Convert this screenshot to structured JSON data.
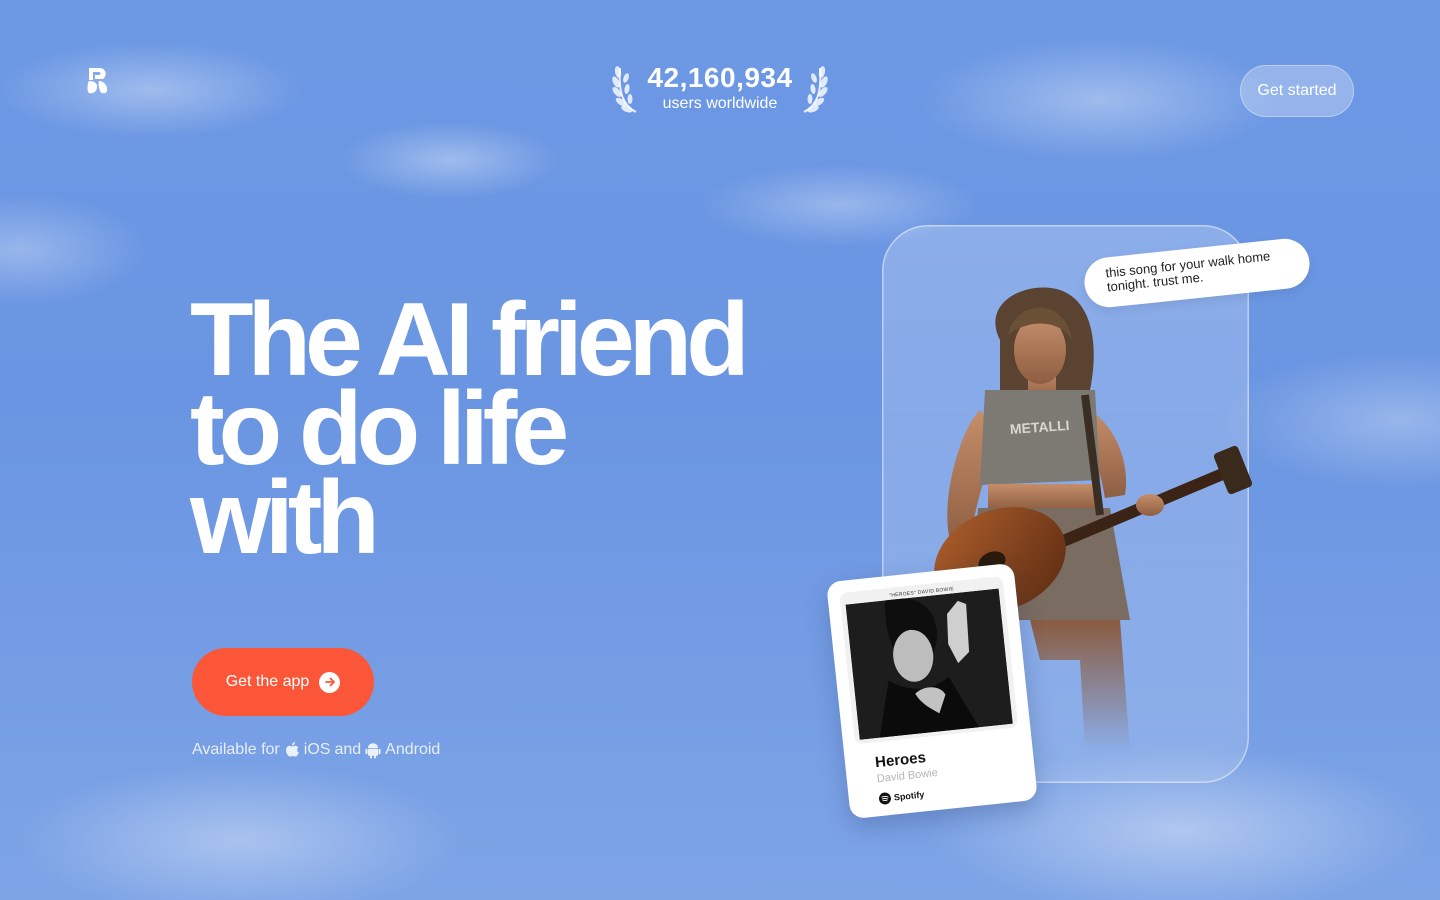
{
  "header": {
    "logo_icon": "replika-logo-icon",
    "user_count": "42,160,934",
    "user_count_label": "users worldwide",
    "get_started_label": "Get started"
  },
  "hero": {
    "headline_lines": [
      "The AI friend",
      "to do life",
      "with"
    ],
    "cta_label": "Get the app",
    "availability": {
      "prefix": "Available for",
      "ios": "iOS",
      "and": "and",
      "android": "Android"
    }
  },
  "showcase": {
    "speech_bubble": "this song for your walk home tonight. trust me.",
    "song": {
      "album_title": "\"HEROES\" DAVID BOWIE",
      "title": "Heroes",
      "artist": "David Bowie",
      "service": "Spotify"
    }
  },
  "colors": {
    "sky": "#6c98e4",
    "cta": "#fb5638",
    "white": "#ffffff"
  }
}
